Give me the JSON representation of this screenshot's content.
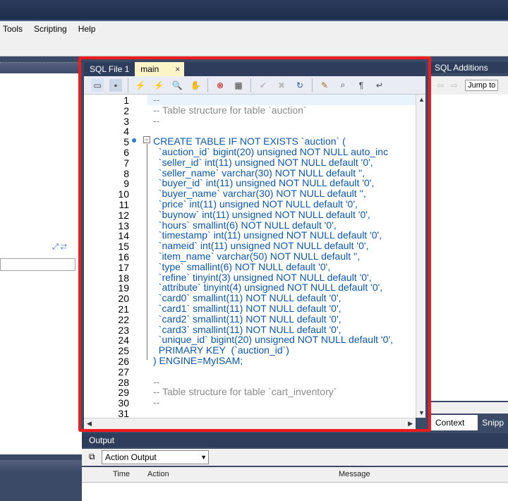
{
  "menu": [
    "Tools",
    "Scripting",
    "Help"
  ],
  "tabs": {
    "first": "SQL File 1",
    "second": "main",
    "close": "×"
  },
  "code_lines": [
    {
      "n": "1",
      "t": "--",
      "cls": "c"
    },
    {
      "n": "2",
      "t": "-- Table structure for table `auction`",
      "cls": "c"
    },
    {
      "n": "3",
      "t": "--",
      "cls": "c"
    },
    {
      "n": "4",
      "t": "",
      "cls": "c"
    },
    {
      "n": "5",
      "t": "CREATE TABLE IF NOT EXISTS `auction` (",
      "cls": "k"
    },
    {
      "n": "6",
      "t": "  `auction_id` bigint(20) unsigned NOT NULL auto_inc",
      "cls": "k"
    },
    {
      "n": "7",
      "t": "  `seller_id` int(11) unsigned NOT NULL default '0',",
      "cls": "k"
    },
    {
      "n": "8",
      "t": "  `seller_name` varchar(30) NOT NULL default '',",
      "cls": "k"
    },
    {
      "n": "9",
      "t": "  `buyer_id` int(11) unsigned NOT NULL default '0',",
      "cls": "k"
    },
    {
      "n": "10",
      "t": "  `buyer_name` varchar(30) NOT NULL default '',",
      "cls": "k"
    },
    {
      "n": "11",
      "t": "  `price` int(11) unsigned NOT NULL default '0',",
      "cls": "k"
    },
    {
      "n": "12",
      "t": "  `buynow` int(11) unsigned NOT NULL default '0',",
      "cls": "k"
    },
    {
      "n": "13",
      "t": "  `hours` smallint(6) NOT NULL default '0',",
      "cls": "k"
    },
    {
      "n": "14",
      "t": "  `timestamp` int(11) unsigned NOT NULL default '0',",
      "cls": "k"
    },
    {
      "n": "15",
      "t": "  `nameid` int(11) unsigned NOT NULL default '0',",
      "cls": "k"
    },
    {
      "n": "16",
      "t": "  `item_name` varchar(50) NOT NULL default '',",
      "cls": "k"
    },
    {
      "n": "17",
      "t": "  `type` smallint(6) NOT NULL default '0',",
      "cls": "k"
    },
    {
      "n": "18",
      "t": "  `refine` tinyint(3) unsigned NOT NULL default '0',",
      "cls": "k"
    },
    {
      "n": "19",
      "t": "  `attribute` tinyint(4) unsigned NOT NULL default '0',",
      "cls": "k"
    },
    {
      "n": "20",
      "t": "  `card0` smallint(11) NOT NULL default '0',",
      "cls": "k"
    },
    {
      "n": "21",
      "t": "  `card1` smallint(11) NOT NULL default '0',",
      "cls": "k"
    },
    {
      "n": "22",
      "t": "  `card2` smallint(11) NOT NULL default '0',",
      "cls": "k"
    },
    {
      "n": "23",
      "t": "  `card3` smallint(11) NOT NULL default '0',",
      "cls": "k"
    },
    {
      "n": "24",
      "t": "  `unique_id` bigint(20) unsigned NOT NULL default '0',",
      "cls": "k"
    },
    {
      "n": "25",
      "t": "  PRIMARY KEY  (`auction_id`)",
      "cls": "k"
    },
    {
      "n": "26",
      "t": ") ENGINE=MyISAM;",
      "cls": "k"
    },
    {
      "n": "27",
      "t": "",
      "cls": "c"
    },
    {
      "n": "28",
      "t": "--",
      "cls": "c"
    },
    {
      "n": "29",
      "t": "-- Table structure for table `cart_inventory`",
      "cls": "c"
    },
    {
      "n": "30",
      "t": "--",
      "cls": "c"
    },
    {
      "n": "31",
      "t": "",
      "cls": "c"
    }
  ],
  "sql_additions": {
    "title": "SQL Additions",
    "jump": "Jump to",
    "tabs": [
      "Context Help",
      "Snipp"
    ]
  },
  "output": {
    "title": "Output",
    "select": "Action Output",
    "cols": [
      "Time",
      "Action",
      "Message"
    ]
  }
}
